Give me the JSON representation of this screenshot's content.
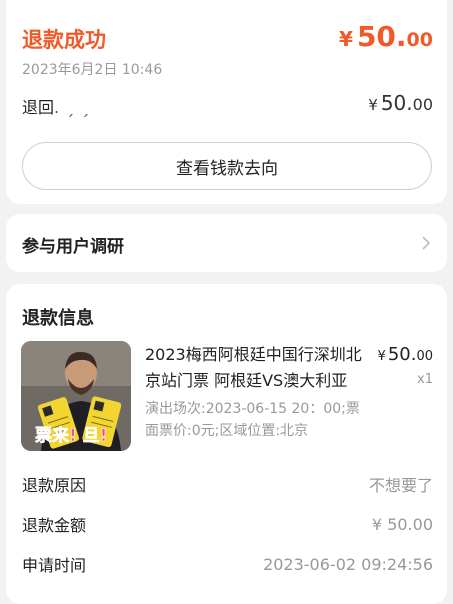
{
  "status": {
    "title": "退款成功",
    "amount_currency": "¥",
    "amount_int": "50.",
    "amount_dec": "00",
    "time": "2023年6月2日 10:46",
    "refund_to_label": "退回",
    "refund_to_masked": ".  ˏ         ˏ",
    "refund_currency": "¥",
    "refund_int": "50.",
    "refund_dec": "00",
    "flow_button": "查看钱款去向",
    "accent_color": "#f05a28"
  },
  "survey": {
    "label": "参与用户调研",
    "icon": "chevron-right-icon"
  },
  "refund_info": {
    "title": "退款信息",
    "product": {
      "name": "2023梅西阿根廷中国行深圳北京站门票 阿根廷VS澳大利亚",
      "spec": "演出场次:2023-06-15 20：00;票面票价:0元;区域位置:北京",
      "currency": "¥",
      "price_int": "50.",
      "price_dec": "00",
      "quantity": "x1",
      "image_caption": "票来! 旦!"
    },
    "rows": [
      {
        "label": "退款原因",
        "value": "不想要了"
      },
      {
        "label": "退款金额",
        "value": "¥ 50.00"
      },
      {
        "label": "申请时间",
        "value": "2023-06-02 09:24:56"
      }
    ]
  }
}
